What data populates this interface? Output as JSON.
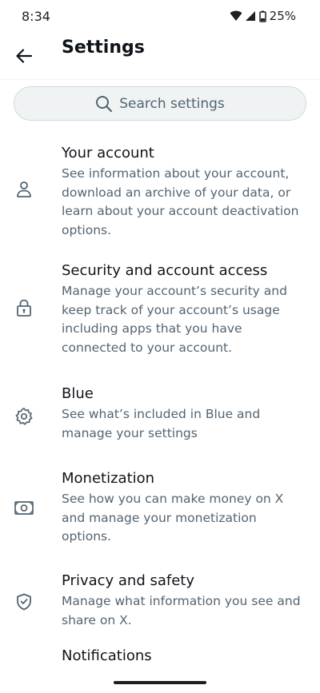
{
  "status": {
    "time": "8:34",
    "battery": "25%"
  },
  "header": {
    "title": "Settings"
  },
  "search": {
    "placeholder": "Search settings"
  },
  "items": [
    {
      "title": "Your account",
      "desc": "See information about your account, download an archive of your data, or learn about your account deactivation options.",
      "icon": "person-icon"
    },
    {
      "title": "Security and account access",
      "desc": "Manage your account’s security and keep track of your account’s usage including apps that you have connected to your account.",
      "icon": "lock-icon"
    },
    {
      "title": "Blue",
      "desc": "See what’s included in Blue and manage your settings",
      "icon": "gear-icon"
    },
    {
      "title": "Monetization",
      "desc": "See how you can make money on X and manage your monetization options.",
      "icon": "money-icon"
    },
    {
      "title": "Privacy and safety",
      "desc": "Manage what information you see and share on X.",
      "icon": "shield-check-icon"
    },
    {
      "title": "Notifications",
      "desc": "",
      "icon": ""
    }
  ],
  "colors": {
    "text_primary": "#0f1419",
    "text_secondary": "#536471",
    "search_bg": "#eff3f4",
    "divider": "#eff3f4"
  }
}
